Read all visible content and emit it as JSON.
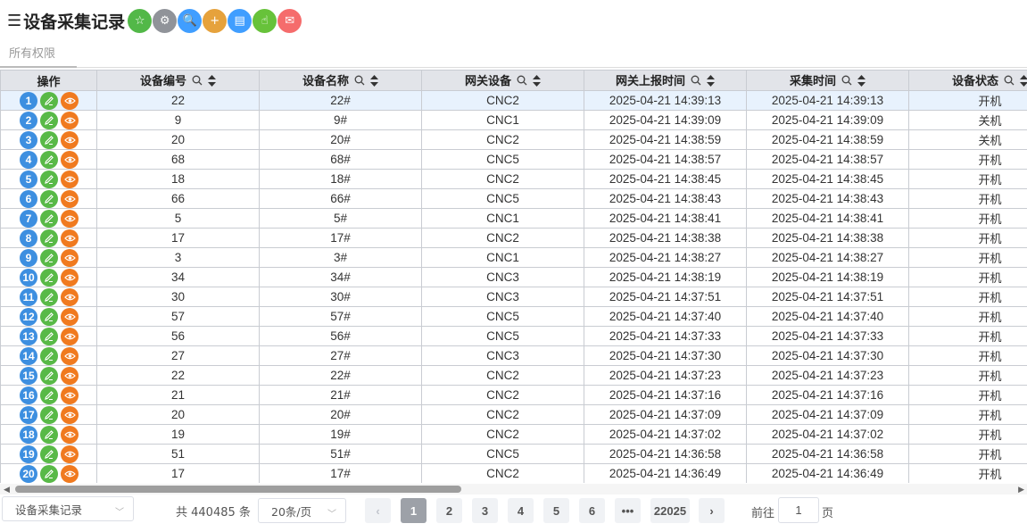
{
  "page": {
    "title": "设备采集记录",
    "menu_glyph": "☰",
    "subtitle": "所有权限"
  },
  "toolbar": [
    {
      "name": "favorite-button",
      "icon": "star-icon",
      "color": "#52b848",
      "glyph": "☆"
    },
    {
      "name": "settings-button",
      "icon": "gear-icon",
      "color": "#909399",
      "glyph": "⚙"
    },
    {
      "name": "search-button",
      "icon": "search-icon",
      "color": "#409eff",
      "glyph": "🔍"
    },
    {
      "name": "add-button",
      "icon": "plus-icon",
      "color": "#e6a23c",
      "glyph": "+"
    },
    {
      "name": "export-button",
      "icon": "document-icon",
      "color": "#409eff",
      "glyph": "▤"
    },
    {
      "name": "touch-button",
      "icon": "hand-pointer-icon",
      "color": "#67c23a",
      "glyph": "☝"
    },
    {
      "name": "message-button",
      "icon": "envelope-icon",
      "color": "#f56c6c",
      "glyph": "✉"
    }
  ],
  "table": {
    "columns": [
      {
        "key": "ops",
        "label": "操作"
      },
      {
        "key": "device_no",
        "label": "设备编号"
      },
      {
        "key": "device_name",
        "label": "设备名称"
      },
      {
        "key": "gateway",
        "label": "网关设备"
      },
      {
        "key": "report_time",
        "label": "网关上报时间"
      },
      {
        "key": "collect_time",
        "label": "采集时间"
      },
      {
        "key": "status",
        "label": "设备状态"
      }
    ],
    "rows": [
      {
        "idx": "1",
        "device_no": "22",
        "device_name": "22#",
        "gateway": "CNC2",
        "report_time": "2025-04-21 14:39:13",
        "collect_time": "2025-04-21 14:39:13",
        "status": "开机"
      },
      {
        "idx": "2",
        "device_no": "9",
        "device_name": "9#",
        "gateway": "CNC1",
        "report_time": "2025-04-21 14:39:09",
        "collect_time": "2025-04-21 14:39:09",
        "status": "关机"
      },
      {
        "idx": "3",
        "device_no": "20",
        "device_name": "20#",
        "gateway": "CNC2",
        "report_time": "2025-04-21 14:38:59",
        "collect_time": "2025-04-21 14:38:59",
        "status": "关机"
      },
      {
        "idx": "4",
        "device_no": "68",
        "device_name": "68#",
        "gateway": "CNC5",
        "report_time": "2025-04-21 14:38:57",
        "collect_time": "2025-04-21 14:38:57",
        "status": "开机"
      },
      {
        "idx": "5",
        "device_no": "18",
        "device_name": "18#",
        "gateway": "CNC2",
        "report_time": "2025-04-21 14:38:45",
        "collect_time": "2025-04-21 14:38:45",
        "status": "开机"
      },
      {
        "idx": "6",
        "device_no": "66",
        "device_name": "66#",
        "gateway": "CNC5",
        "report_time": "2025-04-21 14:38:43",
        "collect_time": "2025-04-21 14:38:43",
        "status": "开机"
      },
      {
        "idx": "7",
        "device_no": "5",
        "device_name": "5#",
        "gateway": "CNC1",
        "report_time": "2025-04-21 14:38:41",
        "collect_time": "2025-04-21 14:38:41",
        "status": "开机"
      },
      {
        "idx": "8",
        "device_no": "17",
        "device_name": "17#",
        "gateway": "CNC2",
        "report_time": "2025-04-21 14:38:38",
        "collect_time": "2025-04-21 14:38:38",
        "status": "开机"
      },
      {
        "idx": "9",
        "device_no": "3",
        "device_name": "3#",
        "gateway": "CNC1",
        "report_time": "2025-04-21 14:38:27",
        "collect_time": "2025-04-21 14:38:27",
        "status": "开机"
      },
      {
        "idx": "10",
        "device_no": "34",
        "device_name": "34#",
        "gateway": "CNC3",
        "report_time": "2025-04-21 14:38:19",
        "collect_time": "2025-04-21 14:38:19",
        "status": "开机"
      },
      {
        "idx": "11",
        "device_no": "30",
        "device_name": "30#",
        "gateway": "CNC3",
        "report_time": "2025-04-21 14:37:51",
        "collect_time": "2025-04-21 14:37:51",
        "status": "开机"
      },
      {
        "idx": "12",
        "device_no": "57",
        "device_name": "57#",
        "gateway": "CNC5",
        "report_time": "2025-04-21 14:37:40",
        "collect_time": "2025-04-21 14:37:40",
        "status": "开机"
      },
      {
        "idx": "13",
        "device_no": "56",
        "device_name": "56#",
        "gateway": "CNC5",
        "report_time": "2025-04-21 14:37:33",
        "collect_time": "2025-04-21 14:37:33",
        "status": "开机"
      },
      {
        "idx": "14",
        "device_no": "27",
        "device_name": "27#",
        "gateway": "CNC3",
        "report_time": "2025-04-21 14:37:30",
        "collect_time": "2025-04-21 14:37:30",
        "status": "开机"
      },
      {
        "idx": "15",
        "device_no": "22",
        "device_name": "22#",
        "gateway": "CNC2",
        "report_time": "2025-04-21 14:37:23",
        "collect_time": "2025-04-21 14:37:23",
        "status": "开机"
      },
      {
        "idx": "16",
        "device_no": "21",
        "device_name": "21#",
        "gateway": "CNC2",
        "report_time": "2025-04-21 14:37:16",
        "collect_time": "2025-04-21 14:37:16",
        "status": "开机"
      },
      {
        "idx": "17",
        "device_no": "20",
        "device_name": "20#",
        "gateway": "CNC2",
        "report_time": "2025-04-21 14:37:09",
        "collect_time": "2025-04-21 14:37:09",
        "status": "开机"
      },
      {
        "idx": "18",
        "device_no": "19",
        "device_name": "19#",
        "gateway": "CNC2",
        "report_time": "2025-04-21 14:37:02",
        "collect_time": "2025-04-21 14:37:02",
        "status": "开机"
      },
      {
        "idx": "19",
        "device_no": "51",
        "device_name": "51#",
        "gateway": "CNC5",
        "report_time": "2025-04-21 14:36:58",
        "collect_time": "2025-04-21 14:36:58",
        "status": "开机"
      },
      {
        "idx": "20",
        "device_no": "17",
        "device_name": "17#",
        "gateway": "CNC2",
        "report_time": "2025-04-21 14:36:49",
        "collect_time": "2025-04-21 14:36:49",
        "status": "开机"
      }
    ]
  },
  "footer": {
    "view_select": "设备采集记录",
    "total_text": "共 440485 条",
    "page_size": "20条/页",
    "pages": [
      "1",
      "2",
      "3",
      "4",
      "5",
      "6",
      "•••",
      "22025"
    ],
    "current_page": "1",
    "goto_prefix": "前往",
    "goto_value": "1",
    "goto_suffix": "页"
  }
}
